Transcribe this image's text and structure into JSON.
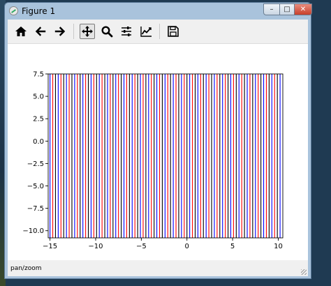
{
  "window": {
    "title": "Figure 1"
  },
  "toolbar": {
    "items": [
      {
        "name": "home-button",
        "icon": "home-icon"
      },
      {
        "name": "back-button",
        "icon": "arrow-left-icon"
      },
      {
        "name": "forward-button",
        "icon": "arrow-right-icon"
      },
      {
        "name": "pan-button",
        "icon": "move-icon",
        "active": true
      },
      {
        "name": "zoom-button",
        "icon": "magnifier-icon"
      },
      {
        "name": "subplots-button",
        "icon": "sliders-icon"
      },
      {
        "name": "edit-axes-button",
        "icon": "chart-line-icon"
      },
      {
        "name": "save-button",
        "icon": "floppy-icon"
      }
    ]
  },
  "status": {
    "text": "pan/zoom"
  },
  "chart_data": {
    "type": "line",
    "title": "",
    "xlabel": "",
    "ylabel": "",
    "xlim": [
      -15.2,
      10.5
    ],
    "ylim": [
      -10.8,
      7.5
    ],
    "x_ticks": [
      -15,
      -10,
      -5,
      0,
      5,
      10
    ],
    "x_tick_labels": [
      "−15",
      "−10",
      "−5",
      "0",
      "5",
      "10"
    ],
    "y_ticks": [
      7.5,
      5.0,
      2.5,
      0.0,
      -2.5,
      -5.0,
      -7.5,
      -10.0
    ],
    "y_tick_labels": [
      "7.5",
      "5.0",
      "2.5",
      "0.0",
      "−2.5",
      "−5.0",
      "−7.5",
      "−10.0"
    ],
    "grid": false,
    "series": [
      {
        "color": "#0000ff",
        "x_start": -15.0,
        "x_end": 10.4,
        "x_step": 0.9,
        "y": [
          -10.8,
          7.5
        ]
      },
      {
        "color": "#ff0000",
        "x_start": -14.7,
        "x_end": 10.4,
        "x_step": 0.9,
        "y": [
          -10.8,
          7.5
        ]
      },
      {
        "color": "#000000",
        "x_start": -14.4,
        "x_end": 10.4,
        "x_step": 0.9,
        "y": [
          -10.8,
          7.5
        ]
      }
    ],
    "colors": {
      "blue": "#0000ff",
      "red": "#ff0000",
      "black": "#000000"
    }
  }
}
